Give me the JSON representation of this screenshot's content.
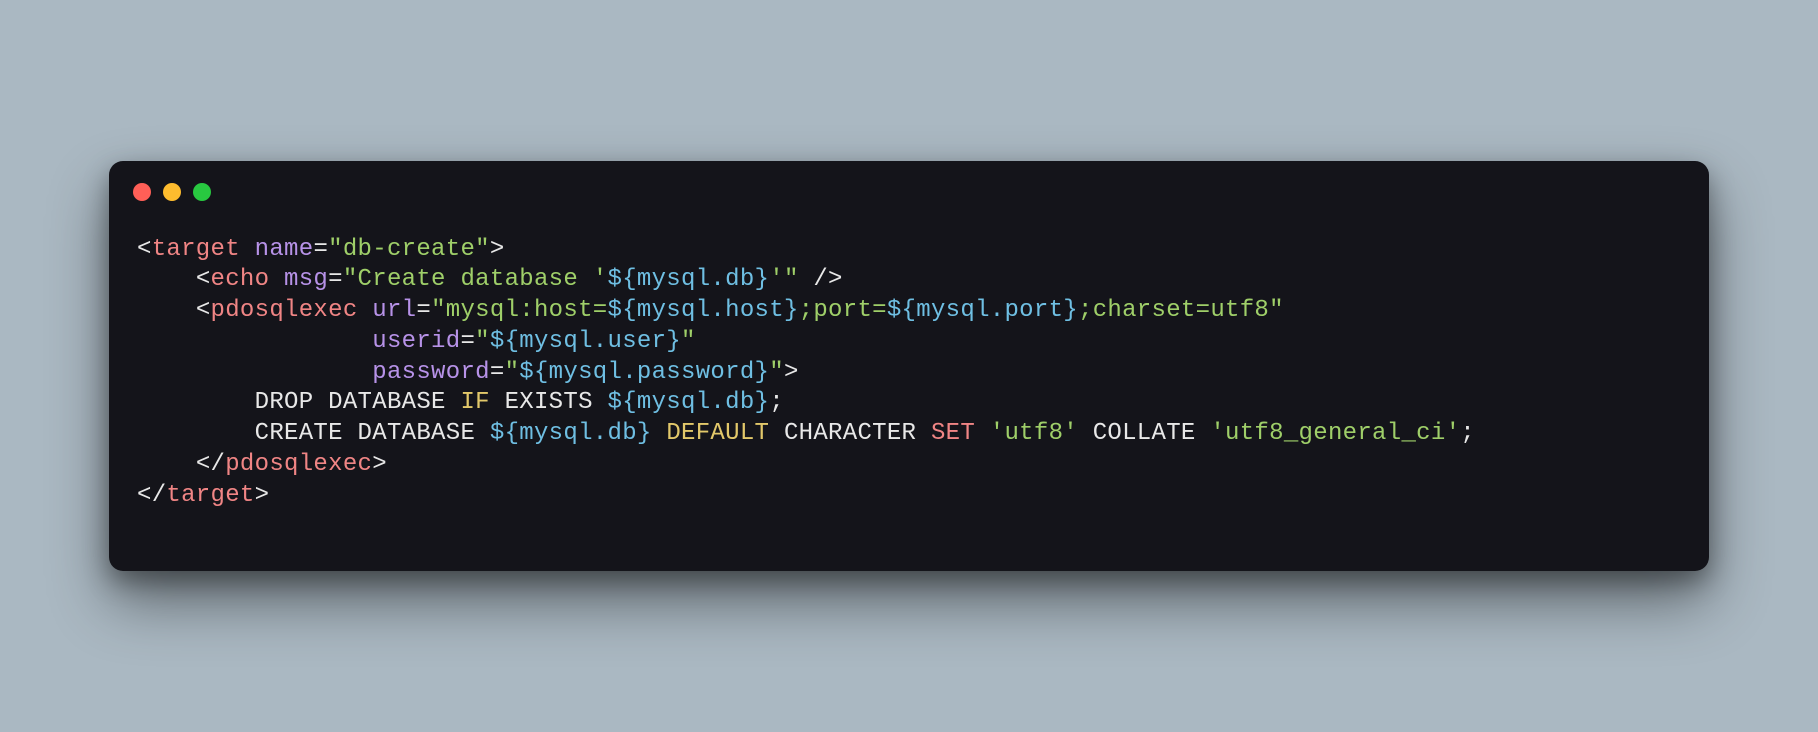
{
  "window": {
    "dots": [
      "red",
      "yellow",
      "green"
    ]
  },
  "code": {
    "line1_open": "<",
    "line1_tag": "target",
    "line1_attr": "name",
    "line1_eq": "=",
    "line1_val_q1": "\"",
    "line1_val": "db-create",
    "line1_val_q2": "\"",
    "line1_close": ">",
    "line2_indent": "    ",
    "line2_open": "<",
    "line2_tag": "echo",
    "line2_attr": "msg",
    "line2_eq": "=",
    "line2_q1": "\"",
    "line2_s1": "Create database '",
    "line2_interp": "${mysql.db}",
    "line2_s2": "'",
    "line2_q2": "\"",
    "line2_close": " />",
    "line3_indent": "    ",
    "line3_open": "<",
    "line3_tag": "pdosqlexec",
    "line3_attr": "url",
    "line3_eq": "=",
    "line3_q1": "\"",
    "line3_s1": "mysql:host=",
    "line3_i1": "${mysql.host}",
    "line3_s2": ";port=",
    "line3_i2": "${mysql.port}",
    "line3_s3": ";charset=utf8",
    "line3_q2": "\"",
    "line4_indent": "                ",
    "line4_attr": "userid",
    "line4_eq": "=",
    "line4_q1": "\"",
    "line4_i1": "${mysql.user}",
    "line4_q2": "\"",
    "line5_indent": "                ",
    "line5_attr": "password",
    "line5_eq": "=",
    "line5_q1": "\"",
    "line5_i1": "${mysql.password}",
    "line5_q2": "\"",
    "line5_close": ">",
    "line6_indent": "        ",
    "line6_kw1": "DROP",
    "line6_sp1": " ",
    "line6_kw2": "DATABASE",
    "line6_sp2": " ",
    "line6_kw3": "IF",
    "line6_sp3": " ",
    "line6_kw4": "EXISTS",
    "line6_sp4": " ",
    "line6_i1": "${mysql.db}",
    "line6_semi": ";",
    "line7_indent": "        ",
    "line7_kw1": "CREATE",
    "line7_sp1": " ",
    "line7_kw2": "DATABASE",
    "line7_sp2": " ",
    "line7_i1": "${mysql.db}",
    "line7_sp3": " ",
    "line7_kw3": "DEFAULT",
    "line7_sp4": " ",
    "line7_kw4": "CHARACTER",
    "line7_sp5": " ",
    "line7_kw5": "SET",
    "line7_sp6": " ",
    "line7_str1": "'utf8'",
    "line7_sp7": " ",
    "line7_kw6": "COLLATE",
    "line7_sp8": " ",
    "line7_str2": "'utf8_general_ci'",
    "line7_semi": ";",
    "line8_indent": "    ",
    "line8_open": "</",
    "line8_tag": "pdosqlexec",
    "line8_close": ">",
    "line9_open": "</",
    "line9_tag": "target",
    "line9_close": ">"
  }
}
